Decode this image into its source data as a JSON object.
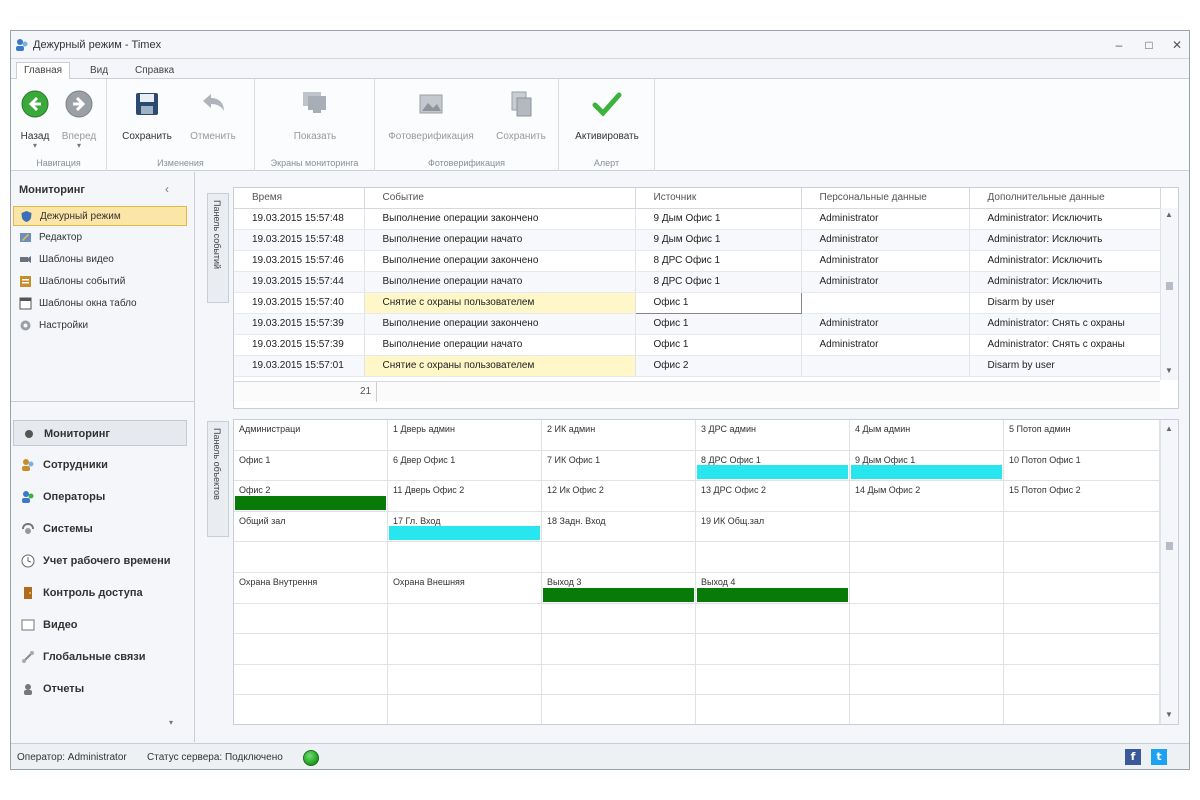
{
  "window": {
    "title": "Дежурный режим - Timex",
    "controls": [
      "minimize",
      "maximize",
      "close"
    ]
  },
  "menu_tabs": [
    {
      "label": "Главная",
      "active": true
    },
    {
      "label": "Вид",
      "active": false
    },
    {
      "label": "Справка",
      "active": false
    }
  ],
  "ribbon": {
    "groups": [
      {
        "name": "Навигация",
        "buttons": [
          {
            "label": "Назад",
            "icon": "back-arrow-icon",
            "enabled": true
          },
          {
            "label": "Вперед",
            "icon": "forward-arrow-icon",
            "enabled": false
          }
        ]
      },
      {
        "name": "Изменения",
        "buttons": [
          {
            "label": "Сохранить",
            "icon": "floppy-disk-icon",
            "enabled": true
          },
          {
            "label": "Отменить",
            "icon": "undo-icon",
            "enabled": false
          }
        ]
      },
      {
        "name": "Экраны мониторинга",
        "buttons": [
          {
            "label": "Показать",
            "icon": "monitors-icon",
            "enabled": false
          }
        ]
      },
      {
        "name": "Фотоверификация",
        "buttons": [
          {
            "label": "Фотоверификация",
            "icon": "photo-icon",
            "enabled": false
          },
          {
            "label": "Сохранить",
            "icon": "save-photo-icon",
            "enabled": false
          }
        ]
      },
      {
        "name": "Алерт",
        "buttons": [
          {
            "label": "Активировать",
            "icon": "checkmark-icon",
            "enabled": true
          }
        ]
      }
    ]
  },
  "sidebar": {
    "header": "Мониторинг",
    "items": [
      {
        "label": "Дежурный режим",
        "icon": "shield-icon",
        "selected": true
      },
      {
        "label": "Редактор",
        "icon": "editor-icon",
        "selected": false
      },
      {
        "label": "Шаблоны видео",
        "icon": "camera-icon",
        "selected": false
      },
      {
        "label": "Шаблоны событий",
        "icon": "events-template-icon",
        "selected": false
      },
      {
        "label": "Шаблоны окна табло",
        "icon": "window-template-icon",
        "selected": false
      },
      {
        "label": "Настройки",
        "icon": "settings-icon",
        "selected": false
      }
    ],
    "nav": [
      {
        "label": "Мониторинг",
        "icon": "monitoring-icon",
        "selected": true
      },
      {
        "label": "Сотрудники",
        "icon": "employees-icon",
        "selected": false
      },
      {
        "label": "Операторы",
        "icon": "operators-icon",
        "selected": false
      },
      {
        "label": "Системы",
        "icon": "systems-icon",
        "selected": false
      },
      {
        "label": "Учет рабочего времени",
        "icon": "clock-icon",
        "selected": false
      },
      {
        "label": "Контроль доступа",
        "icon": "door-icon",
        "selected": false
      },
      {
        "label": "Видео",
        "icon": "video-icon",
        "selected": false
      },
      {
        "label": "Глобальные связи",
        "icon": "link-icon",
        "selected": false
      },
      {
        "label": "Отчеты",
        "icon": "reports-icon",
        "selected": false
      }
    ]
  },
  "vertical_tabs": {
    "events": "Панель событий",
    "plan": "Панель объектов"
  },
  "events": {
    "columns": [
      "Время",
      "Событие",
      "Источник",
      "Персональные данные",
      "Дополнительные данные"
    ],
    "rows": [
      {
        "time": "19.03.2015 15:57:48",
        "event": "Выполнение операции закончено",
        "source": "9 Дым Офис 1",
        "personal": "Administrator",
        "extra": "Administrator: Исключить",
        "highlight": false
      },
      {
        "time": "19.03.2015 15:57:48",
        "event": "Выполнение операции начато",
        "source": "9 Дым Офис 1",
        "personal": "Administrator",
        "extra": "Administrator: Исключить",
        "highlight": false
      },
      {
        "time": "19.03.2015 15:57:46",
        "event": "Выполнение операции закончено",
        "source": "8 ДРС Офис 1",
        "personal": "Administrator",
        "extra": "Administrator: Исключить",
        "highlight": false
      },
      {
        "time": "19.03.2015 15:57:44",
        "event": "Выполнение операции начато",
        "source": "8 ДРС Офис 1",
        "personal": "Administrator",
        "extra": "Administrator: Исключить",
        "highlight": false
      },
      {
        "time": "19.03.2015 15:57:40",
        "event": "Снятие с охраны пользователем",
        "source": "Офис 1",
        "personal": "",
        "extra": "Disarm by user",
        "highlight": true
      },
      {
        "time": "19.03.2015 15:57:39",
        "event": "Выполнение операции закончено",
        "source": "Офис 1",
        "personal": "Administrator",
        "extra": "Administrator: Снять с охраны",
        "highlight": false
      },
      {
        "time": "19.03.2015 15:57:39",
        "event": "Выполнение операции начато",
        "source": "Офис 1",
        "personal": "Administrator",
        "extra": "Administrator: Снять с охраны",
        "highlight": false
      },
      {
        "time": "19.03.2015 15:57:01",
        "event": "Снятие с охраны пользователем",
        "source": "Офис 2",
        "personal": "",
        "extra": "Disarm by user",
        "highlight": true
      }
    ],
    "count": "21"
  },
  "plan": {
    "cells": [
      [
        "Администраци",
        "1 Дверь админ",
        "2 ИК админ",
        "3 ДРС админ",
        "4 Дым админ",
        "5 Потоп админ"
      ],
      [
        "Офис 1",
        "6 Двер Офис 1",
        "7 ИК Офис 1",
        "8 ДРС Офис 1",
        "9 Дым Офис 1",
        "10 Потоп Офис 1"
      ],
      [
        "Офис 2",
        "11 Дверь Офис 2",
        "12 Ик Офис 2",
        "13 ДРС Офис 2",
        "14 Дым Офис 2",
        "15 Потоп Офис 2"
      ],
      [
        "Общий зал",
        "17 Гл. Вход",
        "18 Задн. Вход",
        "19 ИК Общ.зал",
        "",
        ""
      ],
      [
        "",
        "",
        "",
        "",
        "",
        ""
      ],
      [
        "Охрана Внутрення",
        "Охрана Внешняя",
        "Выход 3",
        "Выход 4",
        "",
        ""
      ],
      [
        "",
        "",
        "",
        "",
        "",
        ""
      ],
      [
        "",
        "",
        "",
        "",
        "",
        ""
      ],
      [
        "",
        "",
        "",
        "",
        "",
        ""
      ],
      [
        "",
        "",
        "",
        "",
        "",
        ""
      ]
    ],
    "bars": [
      {
        "row": 1,
        "col": 3,
        "color": "#27e6ee"
      },
      {
        "row": 1,
        "col": 4,
        "color": "#27e6ee"
      },
      {
        "row": 2,
        "col": 0,
        "color": "#087a08"
      },
      {
        "row": 3,
        "col": 1,
        "color": "#27e6ee"
      },
      {
        "row": 5,
        "col": 2,
        "color": "#087a08"
      },
      {
        "row": 5,
        "col": 3,
        "color": "#087a08"
      }
    ]
  },
  "status": {
    "operator": "Оператор: Administrator",
    "server": "Статус сервера: Подключено",
    "social": [
      {
        "name": "facebook-icon",
        "glyph": "f",
        "color": "#3b5998"
      },
      {
        "name": "twitter-icon",
        "glyph": "t",
        "color": "#1da1f2"
      }
    ]
  },
  "colors": {
    "accent_selected": "#fbe6a8",
    "highlight_row": "#fff7c8",
    "status_green": "#1f9a1f"
  }
}
